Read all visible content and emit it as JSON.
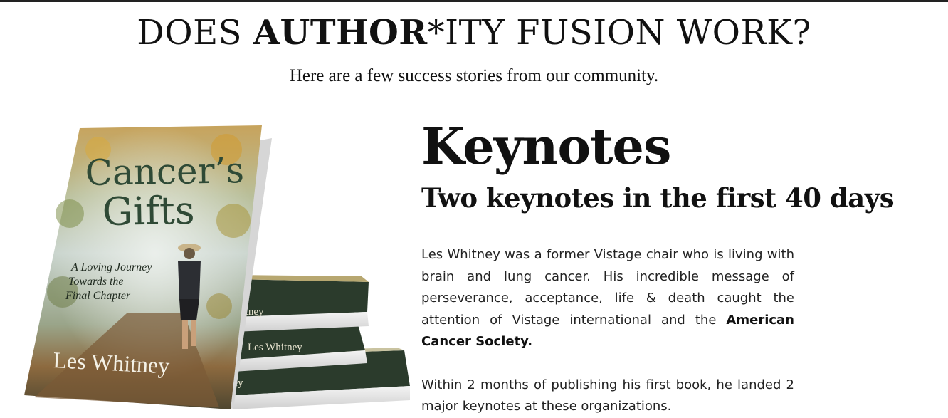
{
  "header": {
    "headline_pre": "DOES ",
    "headline_bold": "AUTHOR",
    "headline_post": "*ITY FUSION WORK?",
    "subheadline": "Here are a few success stories from our community."
  },
  "book": {
    "title_line1": "Cancer’s",
    "title_line2": "Gifts",
    "tagline_line1": "A Loving Journey",
    "tagline_line2": "Towards the",
    "tagline_line3": "Final Chapter",
    "author": "Les Whitney",
    "spine_top": "hitney",
    "spine_mid": "Les Whitney",
    "spine_bottom": "ney"
  },
  "story": {
    "title": "Keynotes",
    "subtitle": "Two keynotes in the first 40 days",
    "paragraph1_text": "Les Whitney was a former Vistage chair who is living with brain and lung cancer. His incredible message of perseverance, acceptance, life & death caught the attention of Vistage international and the ",
    "paragraph1_bold": "American Cancer Society.",
    "paragraph2": "Within 2 months of publishing his first book, he landed 2 major keynotes at these organizations."
  },
  "colors": {
    "text": "#111111",
    "book_title_green": "#2f4a36",
    "book_spine_green": "#2b3b2c"
  }
}
